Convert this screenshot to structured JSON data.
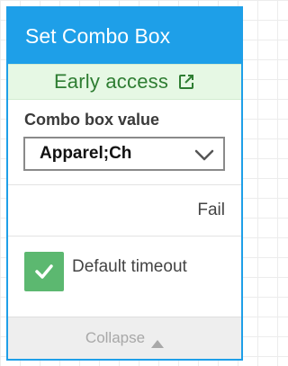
{
  "card": {
    "title": "Set Combo Box",
    "early_access": {
      "label": "Early access",
      "icon": "external-link-icon"
    },
    "combo_field": {
      "label": "Combo box value",
      "value": "Apparel;Ch",
      "icon": "chevron-down-icon"
    },
    "fail_label": "Fail",
    "default_timeout": {
      "label": "Default timeout",
      "checked": true,
      "icon": "checkmark-icon"
    },
    "collapse": {
      "label": "Collapse",
      "icon": "triangle-up-icon"
    }
  },
  "colors": {
    "accent": "#1e9fe8",
    "early_access_bg": "#e6f8e4",
    "early_access_text": "#2e7d32",
    "checkbox": "#5cb870"
  }
}
